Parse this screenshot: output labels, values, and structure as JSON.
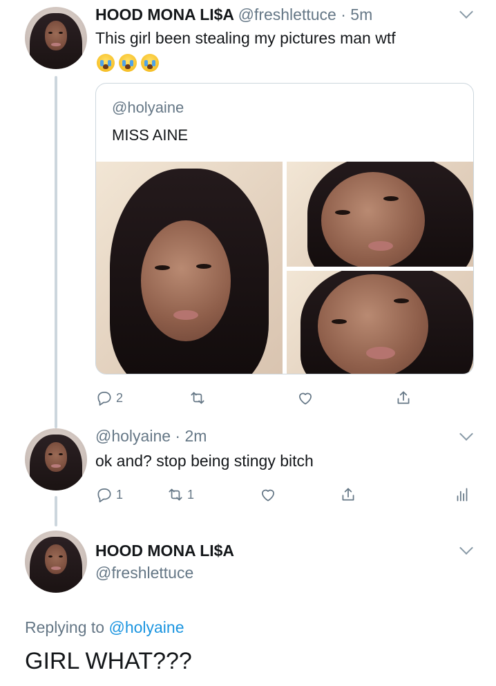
{
  "tweet1": {
    "name": "HOOD MONA LI$A",
    "handle": "@freshlettuce",
    "dot": "·",
    "time": "5m",
    "text": "This girl been stealing my pictures man wtf",
    "emojis": [
      "loudly-crying-face",
      "loudly-crying-face",
      "loudly-crying-face"
    ],
    "quote": {
      "handle": "@holyaine",
      "text": "MISS AINE"
    },
    "actions": {
      "reply_count": "2",
      "retweet_count": "",
      "like_count": ""
    }
  },
  "tweet2": {
    "handle": "@holyaine",
    "dot": "·",
    "time": "2m",
    "text": "ok and? stop being stingy bitch",
    "actions": {
      "reply_count": "1",
      "retweet_count": "1",
      "like_count": ""
    }
  },
  "tweet3": {
    "name": "HOOD MONA LI$A",
    "handle": "@freshlettuce",
    "replying_prefix": "Replying to",
    "replying_handle": "@holyaine",
    "text": "GIRL WHAT???"
  },
  "colors": {
    "text": "#14171a",
    "muted": "#657786",
    "link": "#1b95e0",
    "border": "#ccd6dd"
  }
}
